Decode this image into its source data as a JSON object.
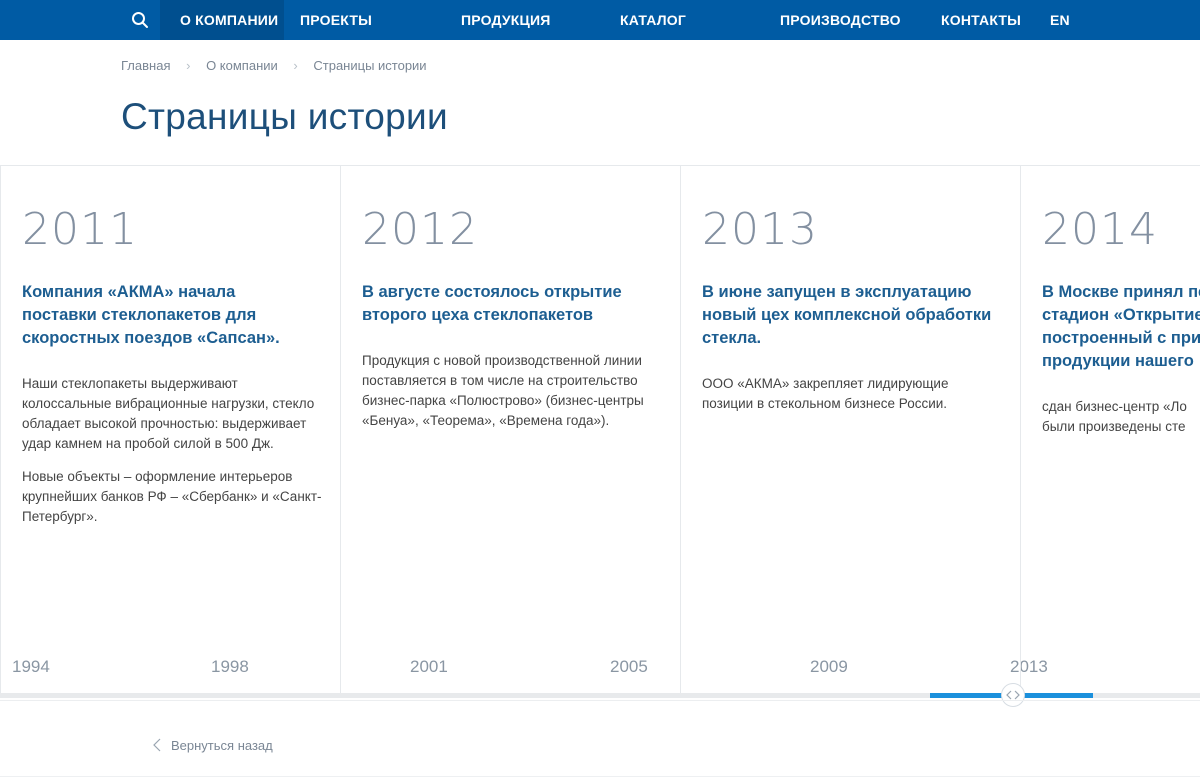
{
  "nav": {
    "items": [
      {
        "label": "О КОМПАНИИ"
      },
      {
        "label": "ПРОЕКТЫ"
      },
      {
        "label": "ПРОДУКЦИЯ"
      },
      {
        "label": "КАТАЛОГ"
      },
      {
        "label": "ПРОИЗВОДСТВО"
      },
      {
        "label": "КОНТАКТЫ"
      },
      {
        "label": "EN"
      }
    ],
    "search_icon": "search-icon",
    "colors": {
      "bar": "#005ba4",
      "active": "#004f8f"
    }
  },
  "breadcrumb": [
    "Главная",
    "О компании",
    "Страницы истории"
  ],
  "page_title": "Страницы истории",
  "timeline": {
    "cards": [
      {
        "year": "2011",
        "heading": "Компания «АКМА» начала поставки стеклопакетов для скоростных поездов «Сапсан».",
        "paragraphs": [
          "Наши стеклопакеты выдерживают колоссальные вибрационные нагрузки, стекло обладает высокой прочностью: выдерживает удар камнем на пробой силой в 500 Дж.",
          "Новые объекты – оформление интерьеров крупнейших банков РФ – «Сбербанк» и «Санкт-Петербург»."
        ]
      },
      {
        "year": "2012",
        "heading": "В августе состоялось открытие второго цеха стеклопакетов",
        "paragraphs": [
          "Продукция с новой производственной линии поставляется в том числе на строительство бизнес-парка «Полюстрово» (бизнес-центры «Бенуа», «Теорема», «Времена года»)."
        ]
      },
      {
        "year": "2013",
        "heading": "В июне запущен в эксплуатацию новый цех комплексной обработки стекла.",
        "paragraphs": [
          "ООО «АКМА» закрепляет лидирующие позиции в стекольном бизнесе России."
        ]
      },
      {
        "year": "2014",
        "heading": "В Москве принял пе стадион «Открытие построенный с при продукции нашего",
        "paragraphs": [
          "сдан бизнес-центр «Ло были произведены сте"
        ]
      }
    ],
    "scale_labels": [
      "1994",
      "1998",
      "2001",
      "2005",
      "2009",
      "2013"
    ],
    "scroll": {
      "position": 0.85,
      "handle_icon": "chevrons-left-right-icon",
      "accent": "#1b90dc"
    }
  },
  "back_link": {
    "label": "Вернуться назад",
    "icon": "chevron-left-icon"
  }
}
